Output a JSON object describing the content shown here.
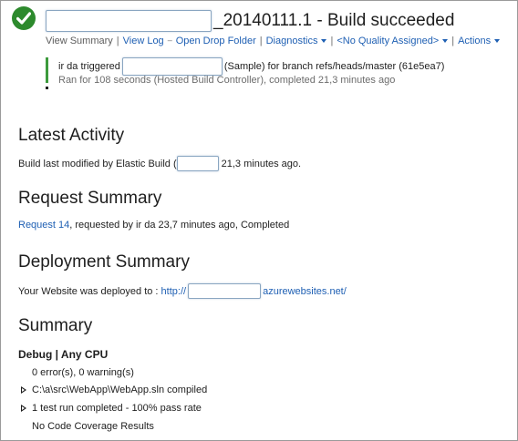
{
  "header": {
    "build_number": "_20140111.1 - Build succeeded"
  },
  "toolbar": {
    "view_summary": "View Summary",
    "view_log": "View Log",
    "open_drop_folder": "Open Drop Folder",
    "diagnostics": "Diagnostics",
    "quality": "<No Quality Assigned>",
    "actions": "Actions"
  },
  "build_info": {
    "trigger_prefix": "ir da triggered",
    "trigger_suffix": "(Sample) for branch refs/heads/master (61e5ea7)",
    "ran_text": "Ran for 108 seconds (Hosted Build Controller), completed 21,3 minutes ago"
  },
  "latest_activity": {
    "heading": "Latest Activity",
    "text_prefix": "Build last modified by Elastic Build (",
    "text_suffix": "21,3 minutes ago."
  },
  "request_summary": {
    "heading": "Request Summary",
    "request_link": "Request 14",
    "request_text": ", requested by ir da 23,7 minutes ago, Completed"
  },
  "deployment_summary": {
    "heading": "Deployment Summary",
    "text": "Your Website was deployed to : ",
    "url_prefix": "http://",
    "url_suffix": "azurewebsites.net/"
  },
  "summary": {
    "heading": "Summary",
    "config": "Debug | Any CPU",
    "errors": "0 error(s), 0 warning(s)",
    "compiled": "C:\\a\\src\\WebApp\\WebApp.sln compiled",
    "tests": "1 test run completed - 100% pass rate",
    "coverage": "No Code Coverage Results"
  },
  "colors": {
    "success_green": "#2d8a2d",
    "link_blue": "#1e5fb3",
    "status_bar_green": "#3c9a3c"
  }
}
